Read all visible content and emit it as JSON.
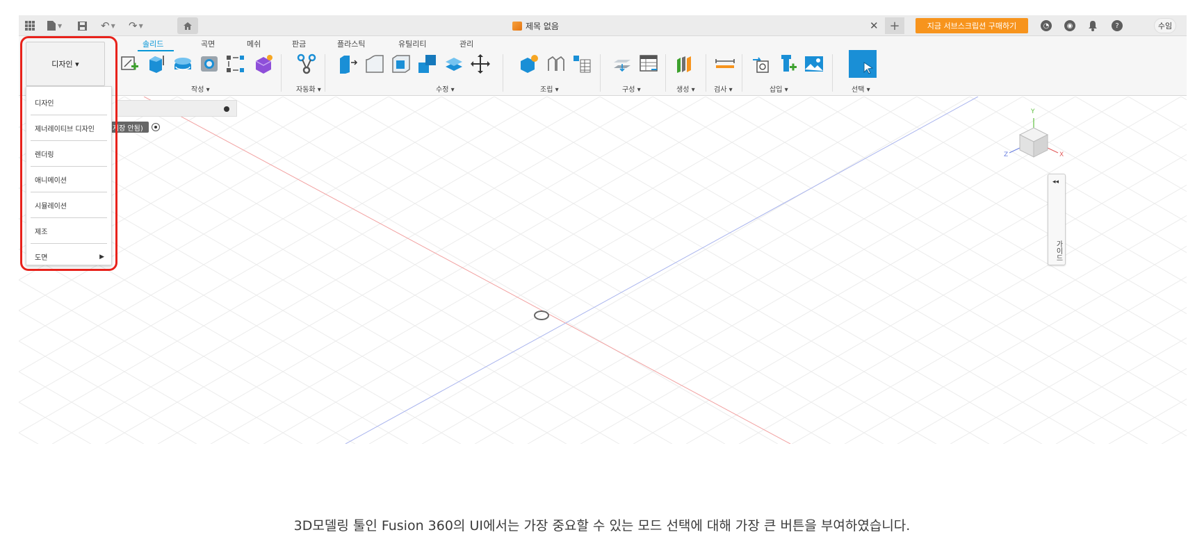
{
  "titlebar": {
    "doc_title": "제목 없음",
    "subscribe_label": "지금 서브스크립션 구매하기",
    "user_initials": "수임"
  },
  "ribbon": {
    "tabs": [
      "솔리드",
      "곡면",
      "메쉬",
      "판금",
      "플라스틱",
      "유틸리티",
      "관리"
    ],
    "active_tab": "솔리드",
    "groups": [
      "작성 ▾",
      "자동화 ▾",
      "수정 ▾",
      "조립 ▾",
      "구성 ▾",
      "생성 ▾",
      "검사 ▾",
      "삽입 ▾",
      "선택 ▾"
    ]
  },
  "mode": {
    "button_label": "디자인 ▾",
    "menu_items": [
      "디자인",
      "제너레이티브 디자인",
      "렌더링",
      "애니메이션",
      "시뮬레이션",
      "제조",
      "도면"
    ],
    "submenu_arrow": "▶"
  },
  "browser": {
    "pill_label": "(저장 안됨)"
  },
  "viewcube": {
    "axis_y": "Y",
    "axis_x": "X",
    "axis_z": "Z"
  },
  "guide_panel": {
    "collapse_glyph": "◂◂",
    "label": "가이드"
  },
  "caption": "3D모델링 툴인 Fusion 360의 UI에서는 가장 중요할 수 있는 모드 선택에 대해 가장 큰 버튼을 부여하였습니다.",
  "colors": {
    "accent_blue": "#0696d7",
    "highlight_red": "#e8221b",
    "subscribe_orange": "#f7941d"
  }
}
